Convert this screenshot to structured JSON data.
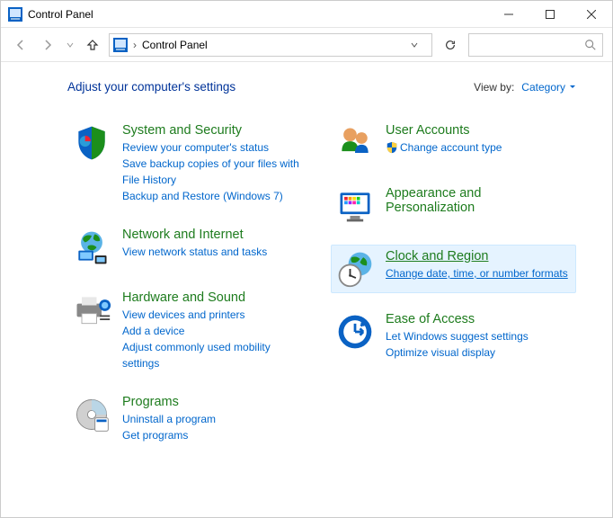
{
  "window": {
    "title": "Control Panel"
  },
  "toolbar": {
    "breadcrumb": "Control Panel"
  },
  "main": {
    "heading": "Adjust your computer's settings",
    "view_by_label": "View by:",
    "view_by_value": "Category"
  },
  "categories": {
    "system_security": {
      "title": "System and Security",
      "links": [
        "Review your computer's status",
        "Save backup copies of your files with File History",
        "Backup and Restore (Windows 7)"
      ]
    },
    "network": {
      "title": "Network and Internet",
      "links": [
        "View network status and tasks"
      ]
    },
    "hardware": {
      "title": "Hardware and Sound",
      "links": [
        "View devices and printers",
        "Add a device",
        "Adjust commonly used mobility settings"
      ]
    },
    "programs": {
      "title": "Programs",
      "links": [
        "Uninstall a program",
        "Get programs"
      ]
    },
    "user_accounts": {
      "title": "User Accounts",
      "links": [
        "Change account type"
      ]
    },
    "appearance": {
      "title": "Appearance and Personalization",
      "links": []
    },
    "clock_region": {
      "title": "Clock and Region",
      "links": [
        "Change date, time, or number formats"
      ]
    },
    "ease": {
      "title": "Ease of Access",
      "links": [
        "Let Windows suggest settings",
        "Optimize visual display"
      ]
    }
  }
}
